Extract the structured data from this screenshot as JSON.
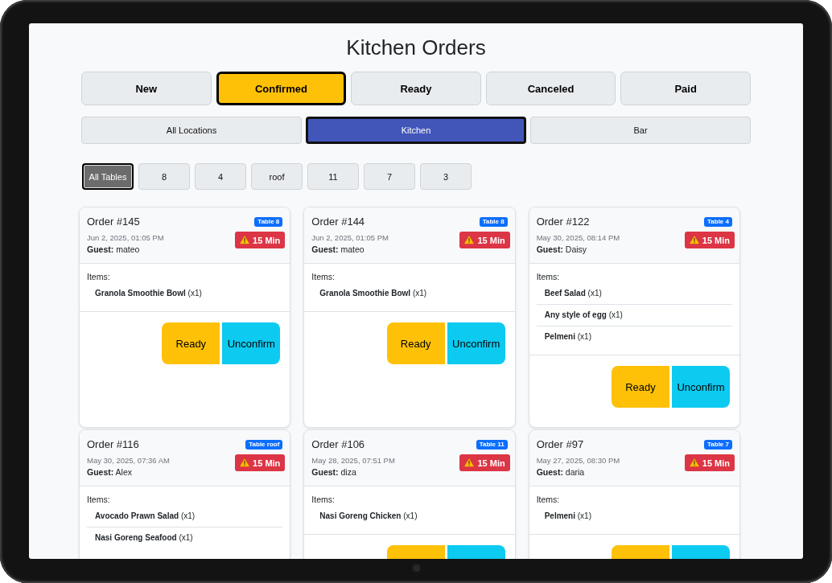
{
  "title": "Kitchen Orders",
  "status_tabs": [
    {
      "label": "New",
      "selected": false
    },
    {
      "label": "Confirmed",
      "selected": true
    },
    {
      "label": "Ready",
      "selected": false
    },
    {
      "label": "Canceled",
      "selected": false
    },
    {
      "label": "Paid",
      "selected": false
    }
  ],
  "location_tabs": [
    {
      "label": "All Locations",
      "selected": false
    },
    {
      "label": "Kitchen",
      "selected": true
    },
    {
      "label": "Bar",
      "selected": false
    }
  ],
  "table_filters": [
    {
      "label": "All Tables",
      "selected": true
    },
    {
      "label": "8",
      "selected": false
    },
    {
      "label": "4",
      "selected": false
    },
    {
      "label": "roof",
      "selected": false
    },
    {
      "label": "11",
      "selected": false
    },
    {
      "label": "7",
      "selected": false
    },
    {
      "label": "3",
      "selected": false
    }
  ],
  "orders": [
    {
      "title": "Order #145",
      "table": "Table 8",
      "date": "Jun 2, 2025, 01:05 PM",
      "guest": "**Guest:** mateo",
      "timer": "15 Min",
      "items_label": "Items:",
      "items": [
        "**Granola Smoothie Bowl** (x1)"
      ],
      "actions": [
        {
          "kind": "ready",
          "label": "Ready"
        },
        {
          "kind": "unconfirm",
          "label": "Unconfirm"
        }
      ]
    },
    {
      "title": "Order #144",
      "table": "Table 8",
      "date": "Jun 2, 2025, 01:05 PM",
      "guest": "**Guest:** mateo",
      "timer": "15 Min",
      "items_label": "Items:",
      "items": [
        "**Granola Smoothie Bowl** (x1)"
      ],
      "actions": [
        {
          "kind": "ready",
          "label": "Ready"
        },
        {
          "kind": "unconfirm",
          "label": "Unconfirm"
        }
      ]
    },
    {
      "title": "Order #122",
      "table": "Table 4",
      "date": "May 30, 2025, 08:14 PM",
      "guest": "**Guest:** Daisy",
      "timer": "15 Min",
      "items_label": "Items:",
      "items": [
        "**Beef Salad** (x1)",
        "**Any style of egg** (x1)",
        "**Pelmeni** (x1)"
      ],
      "actions": [
        {
          "kind": "ready",
          "label": "Ready"
        },
        {
          "kind": "unconfirm",
          "label": "Unconfirm"
        }
      ]
    },
    {
      "title": "Order #116",
      "table": "Table roof",
      "date": "May 30, 2025, 07:36 AM",
      "guest": "**Guest:** Alex",
      "timer": "15 Min",
      "items_label": "Items:",
      "items": [
        "**Avocado Prawn Salad** (x1)",
        "**Nasi Goreng Seafood** (x1)"
      ]
    },
    {
      "title": "Order #106",
      "table": "Table 11",
      "date": "May 28, 2025, 07:51 PM",
      "guest": "**Guest:** diza",
      "timer": "15 Min",
      "items_label": "Items:",
      "items": [
        "**Nasi Goreng Chicken** (x1)"
      ],
      "actions": [
        {
          "kind": "ready"
        },
        {
          "kind": "unconfirm"
        }
      ]
    },
    {
      "title": "Order #97",
      "table": "Table 7",
      "date": "May 27, 2025, 08:30 PM",
      "guest": "**Guest:** daria",
      "timer": "15 Min",
      "items_label": "Items:",
      "items": [
        "**Pelmeni** (x1)"
      ],
      "actions": [
        {
          "kind": "ready"
        },
        {
          "kind": "unconfirm"
        }
      ]
    }
  ]
}
